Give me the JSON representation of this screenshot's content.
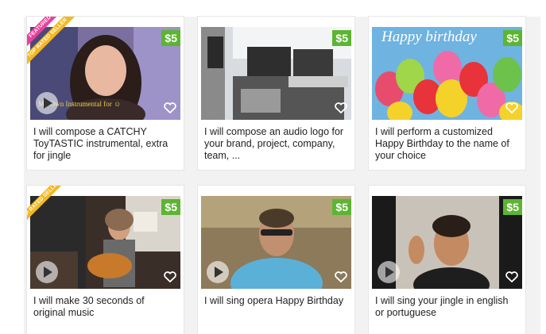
{
  "gigs": [
    {
      "price": "$5",
      "title": "I will compose a CATCHY ToyTASTIC instrumental, extra for jingle",
      "ribbons": [
        "FEATURED",
        "TOP RATED SELLER"
      ],
      "overlay_text": "My Own Instrumental for ☺"
    },
    {
      "price": "$5",
      "title": "I will compose an audio logo for your brand, project, company, team, ...",
      "ribbons": []
    },
    {
      "price": "$5",
      "title": "I will perform a customized Happy Birthday to the name of your choice",
      "ribbons": [],
      "overlay_text": "Happy birthday"
    },
    {
      "price": "$5",
      "title": "I will make 30 seconds of original music",
      "ribbons": [
        "TOP RATED SELLER"
      ]
    },
    {
      "price": "$5",
      "title": "I will sing opera Happy Birthday",
      "ribbons": []
    },
    {
      "price": "$5",
      "title": "I will sing your jingle in english or portuguese",
      "ribbons": []
    }
  ],
  "colors": {
    "price_badge": "#5cb531",
    "featured": "#e8409a",
    "top_rated": "#f4b81e"
  },
  "icons": {
    "heart": "heart-icon",
    "play": "play-icon"
  }
}
